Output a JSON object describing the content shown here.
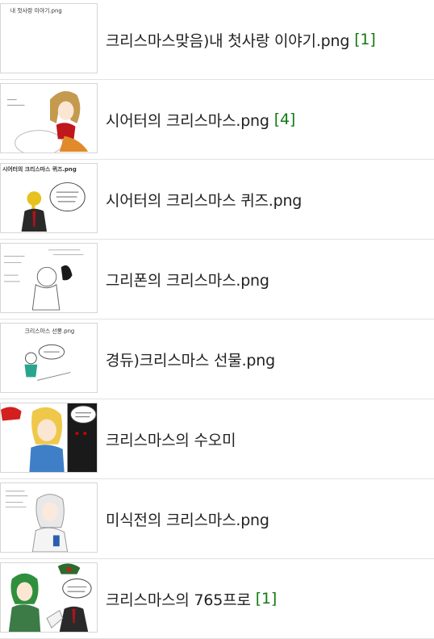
{
  "posts": [
    {
      "title": "크리스마스맞음)내 첫사랑 이야기.png",
      "comments": "[1]",
      "thumb_caption": "내 첫사랑 이야기.png",
      "thumb": "blank-page"
    },
    {
      "title": "시어터의 크리스마스.png",
      "comments": "[4]",
      "thumb_caption": "",
      "thumb": "brown-haired-girl"
    },
    {
      "title": "시어터의 크리스마스 퀴즈.png",
      "comments": "",
      "thumb_caption": "시어터의 크리스마스 퀴즈.png",
      "thumb": "suited-man-speech"
    },
    {
      "title": "그리폰의 크리스마스.png",
      "comments": "",
      "thumb_caption": "",
      "thumb": "stick-figure-sketch"
    },
    {
      "title": "경듀)크리스마스 선물.png",
      "comments": "",
      "thumb_caption": "크리스마스 선물.png",
      "thumb": "small-figure-bubble"
    },
    {
      "title": "크리스마스의 수오미",
      "comments": "",
      "thumb_caption": "",
      "thumb": "blonde-girl-comic"
    },
    {
      "title": "미식전의 크리스마스.png",
      "comments": "",
      "thumb_caption": "",
      "thumb": "white-haired-girl"
    },
    {
      "title": "크리스마스의 765프로",
      "comments": "[1]",
      "thumb_caption": "",
      "thumb": "green-haired-girl"
    }
  ]
}
